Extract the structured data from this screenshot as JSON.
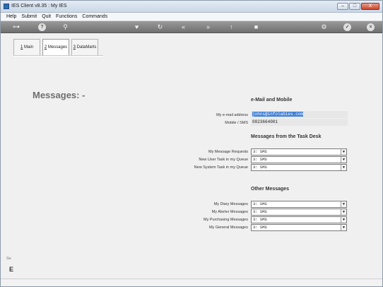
{
  "window": {
    "title": "IES Client v8.35 : My IES"
  },
  "window_buttons": {
    "minimize": "–",
    "maximize": "□",
    "close": "X"
  },
  "menu": {
    "items": [
      "Help",
      "Submit",
      "Quit",
      "Functions",
      "Commands"
    ]
  },
  "toolbar": {
    "icons": [
      "key-icon",
      "help-icon",
      "search-icon",
      "heart-icon",
      "refresh-icon",
      "rewind-icon",
      "fast-forward-icon",
      "upload-icon",
      "stop-icon",
      "settings-icon",
      "check-icon",
      "close-icon"
    ]
  },
  "tabs": [
    {
      "key": "1",
      "label": " Main"
    },
    {
      "key": "2",
      "label": " Messages"
    },
    {
      "key": "3",
      "label": " DataMarts"
    }
  ],
  "page": {
    "title": "Messages: -"
  },
  "email_section": {
    "title": "e-Mail and Mobile",
    "email_label": "My e-mail address",
    "email_value": "johns@infolabies.com",
    "mobile_label": "Mobile / SMS",
    "mobile_value": "0823664001"
  },
  "task_section": {
    "title": "Messages from the Task Desk",
    "rows": [
      {
        "label": "My Message Requests",
        "value": "3: SMS"
      },
      {
        "label": "New User Task in my Queue",
        "value": "3: SMS"
      },
      {
        "label": "New System Task in my Queue",
        "value": "3: SMS"
      }
    ]
  },
  "other_section": {
    "title": "Other Messages",
    "rows": [
      {
        "label": "My Diary Messages",
        "value": "3: SMS"
      },
      {
        "label": "My Alerter Messages",
        "value": "3: SMS"
      },
      {
        "label": "My Purchasing Messages",
        "value": "3: SMS"
      },
      {
        "label": "My General Messages",
        "value": "3: SMS"
      }
    ]
  },
  "sidebar": {
    "fragment": "Se",
    "glyph": "E"
  },
  "colors": {
    "selection": "#3f7fd4",
    "toolbar": "#7f7f7f",
    "title_gray": "#6f6f6f"
  }
}
